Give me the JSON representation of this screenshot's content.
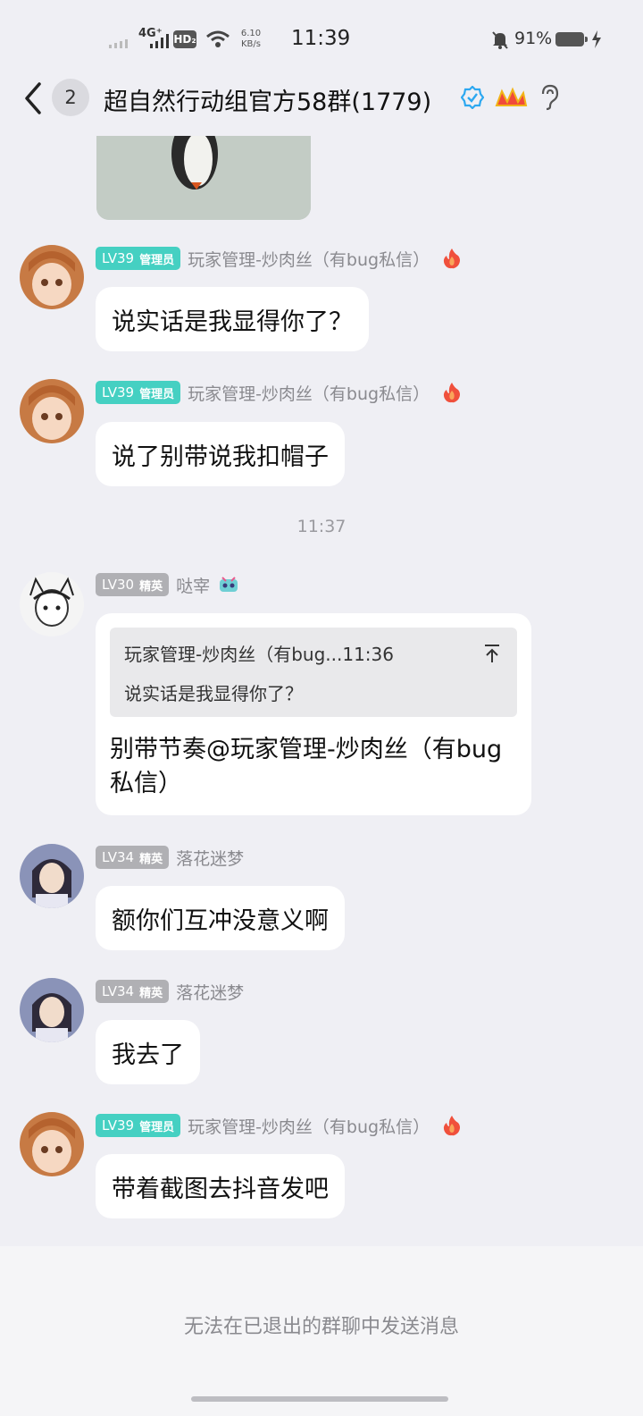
{
  "status_bar": {
    "network": "4G⁺",
    "hd": "HD₂",
    "speed_value": "6.10",
    "speed_unit": "KB/s",
    "time": "11:39",
    "battery": "91%"
  },
  "header": {
    "unread_count": "2",
    "title": "超自然行动组官方58群(1779)"
  },
  "messages": [
    {
      "level": "LV39",
      "role": "管理员",
      "sender": "玩家管理-炒肉丝（有bug私信）",
      "text": "说实话是我显得你了？"
    },
    {
      "level": "LV39",
      "role": "管理员",
      "sender": "玩家管理-炒肉丝（有bug私信）",
      "text": "说了别带说我扣帽子"
    },
    {
      "level": "LV30",
      "role": "精英",
      "sender": "哒宰",
      "quote_header": "玩家管理-炒肉丝（有bug...11:36",
      "quote_text": "说实话是我显得你了？",
      "text": "别带节奏@玩家管理-炒肉丝（有bug私信）"
    },
    {
      "level": "LV34",
      "role": "精英",
      "sender": "落花迷梦",
      "text": "额你们互冲没意义啊"
    },
    {
      "level": "LV34",
      "role": "精英",
      "sender": "落花迷梦",
      "text": "我去了"
    },
    {
      "level": "LV39",
      "role": "管理员",
      "sender": "玩家管理-炒肉丝（有bug私信）",
      "text": "带着截图去抖音发吧"
    }
  ],
  "timestamp": "11:37",
  "footer": {
    "notice": "无法在已退出的群聊中发送消息"
  },
  "colors": {
    "admin_badge": "#45D0C2",
    "elite_badge": "#B0B0B4",
    "background": "#EFEFF4"
  }
}
